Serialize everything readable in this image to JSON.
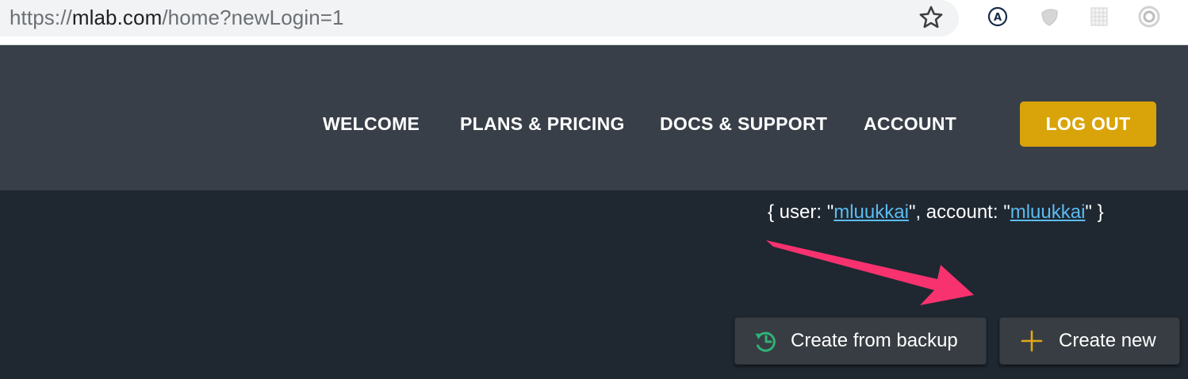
{
  "browser": {
    "url_prefix": "https://",
    "url_domain": "mlab.com",
    "url_path": "/home?newLogin=1",
    "icons": [
      "star-icon",
      "a-circle-extension-icon",
      "grey-shield-extension-icon",
      "grid-extension-icon",
      "circle-target-extension-icon"
    ]
  },
  "nav": {
    "items": [
      {
        "label": "WELCOME"
      },
      {
        "label": "PLANS & PRICING"
      },
      {
        "label": "DOCS & SUPPORT"
      },
      {
        "label": "ACCOUNT"
      }
    ],
    "logout_label": "LOG OUT"
  },
  "user_info": {
    "prefix": "{ user: \"",
    "user": "mluukkai",
    "middle": "\", account: \"",
    "account": "mluukkai",
    "suffix": "\" }"
  },
  "actions": {
    "create_from_backup_label": "Create from backup",
    "create_new_label": "Create new"
  },
  "colors": {
    "header_bg": "#383f48",
    "page_bg": "#1f2731",
    "logout_bg": "#d9a40a",
    "link": "#5bbcf0",
    "annotation_arrow": "#f7326f",
    "backup_icon": "#2fb277",
    "plus_icon": "#e3a715"
  }
}
